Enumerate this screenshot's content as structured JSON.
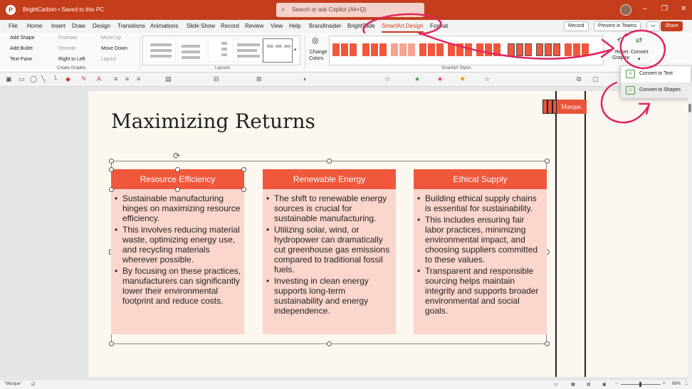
{
  "app": {
    "logo": "P",
    "document_title": "BrightCarbon • Saved to this PC",
    "search_placeholder": "Search or ask Copilot (Alt+Q)",
    "window_controls": [
      "–",
      "❐",
      "✕"
    ]
  },
  "menu": {
    "tabs": [
      "File",
      "Home",
      "Insert",
      "Draw",
      "Design",
      "Transitions",
      "Animations",
      "Slide Show",
      "Record",
      "Review",
      "View",
      "Help",
      "BrandInsider",
      "BrightSlide",
      "SmartArt Design",
      "Format"
    ],
    "active_tab": "SmartArt Design",
    "record": "Record",
    "present_in_teams": "Present in Teams",
    "share": "Share"
  },
  "ribbon": {
    "create_graphic": {
      "add_shape": "Add Shape",
      "add_bullet": "Add Bullet",
      "text_pane": "Text Pane",
      "promote": "Promote",
      "demote": "Demote",
      "right_to_left": "Right to Left",
      "move_up": "Move Up",
      "move_down": "Move Down",
      "layout": "Layout",
      "group_label": "Create Graphic"
    },
    "layouts_label": "Layouts",
    "change_colors": [
      "Change",
      "Colors"
    ],
    "smartart_styles_label": "SmartArt Styles",
    "reset_graphic": [
      "Reset",
      "Graphic"
    ],
    "convert": "Convert"
  },
  "convert_menu": {
    "items": [
      "Convert to Text",
      "Convert to Shapes"
    ]
  },
  "slide": {
    "title": "Maximizing Returns",
    "brand": "Marque.",
    "cards": [
      {
        "heading": "Resource Efficiency",
        "bullets": [
          "Sustainable manufacturing hinges on maximizing resource efficiency.",
          "This involves reducing material waste, optimizing energy use, and recycling materials wherever possible.",
          "By focusing on these practices, manufacturers can significantly lower their environmental footprint and reduce costs."
        ]
      },
      {
        "heading": "Renewable Energy",
        "bullets": [
          "The shift to renewable energy sources is crucial for sustainable manufacturing.",
          "Utilizing solar, wind, or hydropower can dramatically cut greenhouse gas emissions compared to traditional fossil fuels.",
          "Investing in clean energy supports long-term sustainability and energy independence."
        ]
      },
      {
        "heading": "Ethical Supply",
        "bullets": [
          "Building ethical supply chains is essential for sustainability.",
          "This includes ensuring fair labor practices, minimizing environmental impact, and choosing suppliers committed to these values.",
          "Transparent and responsible sourcing helps maintain integrity and supports broader environmental and social goals."
        ]
      }
    ]
  },
  "status": {
    "selection": "\"Marque\"",
    "zoom": "98%"
  },
  "colors": {
    "accent": "#c43e1c",
    "card_header": "#f0573b",
    "card_body": "#fbd6cd",
    "annotation": "#e0245e"
  },
  "icons": [
    "search-icon",
    "avatar",
    "change-colors-icon",
    "reset-graphic-icon",
    "convert-icon",
    "convert-to-text-icon",
    "convert-to-shapes-icon",
    "rotate-handle-icon"
  ]
}
